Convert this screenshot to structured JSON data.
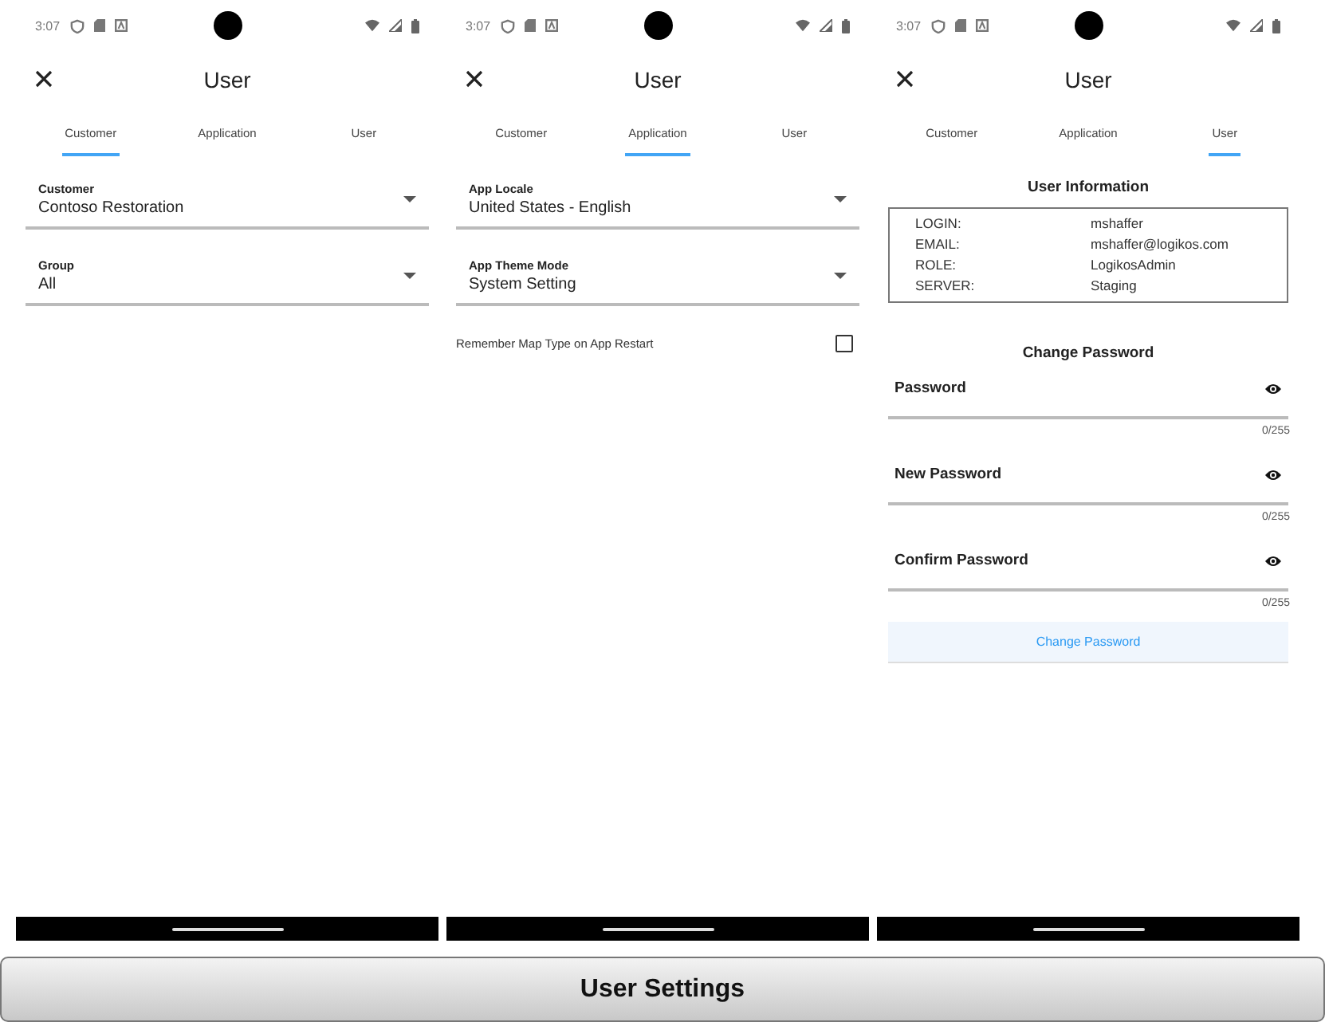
{
  "phones": [
    {
      "status_time": "3:07",
      "title": "User",
      "tabs": [
        {
          "label": "Customer",
          "selected": true
        },
        {
          "label": "Application",
          "selected": false
        },
        {
          "label": "User",
          "selected": false
        }
      ],
      "content": [
        {
          "kind": "dropdown",
          "label": "Customer",
          "value": "Contoso Restoration"
        },
        {
          "kind": "dropdown",
          "label": "Group",
          "value": "All"
        }
      ]
    },
    {
      "status_time": "3:07",
      "title": "User",
      "tabs": [
        {
          "label": "Customer",
          "selected": false
        },
        {
          "label": "Application",
          "selected": true
        },
        {
          "label": "User",
          "selected": false
        }
      ],
      "content": [
        {
          "kind": "dropdown",
          "label": "App Locale",
          "value": "United States - English"
        },
        {
          "kind": "dropdown",
          "label": "App Theme Mode",
          "value": "System Setting"
        },
        {
          "kind": "checkbox",
          "label": "Remember Map Type on App Restart",
          "checked": false
        }
      ]
    },
    {
      "status_time": "3:07",
      "title": "User",
      "tabs": [
        {
          "label": "Customer",
          "selected": false
        },
        {
          "label": "Application",
          "selected": false
        },
        {
          "label": "User",
          "selected": true
        }
      ],
      "content": [
        {
          "kind": "heading",
          "text": "User Information"
        },
        {
          "kind": "info_table",
          "rows": [
            {
              "key": "LOGIN:",
              "value": "mshaffer"
            },
            {
              "key": "EMAIL:",
              "value": "mshaffer@logikos.com"
            },
            {
              "key": "ROLE:",
              "value": "LogikosAdmin"
            },
            {
              "key": "SERVER:",
              "value": "Staging"
            }
          ]
        },
        {
          "kind": "heading",
          "text": "Change Password"
        },
        {
          "kind": "password",
          "label": "Password",
          "counter": "0/255"
        },
        {
          "kind": "password",
          "label": "New Password",
          "counter": "0/255"
        },
        {
          "kind": "password",
          "label": "Confirm Password",
          "counter": "0/255"
        },
        {
          "kind": "button",
          "label": "Change Password"
        }
      ]
    }
  ],
  "caption": "User Settings"
}
